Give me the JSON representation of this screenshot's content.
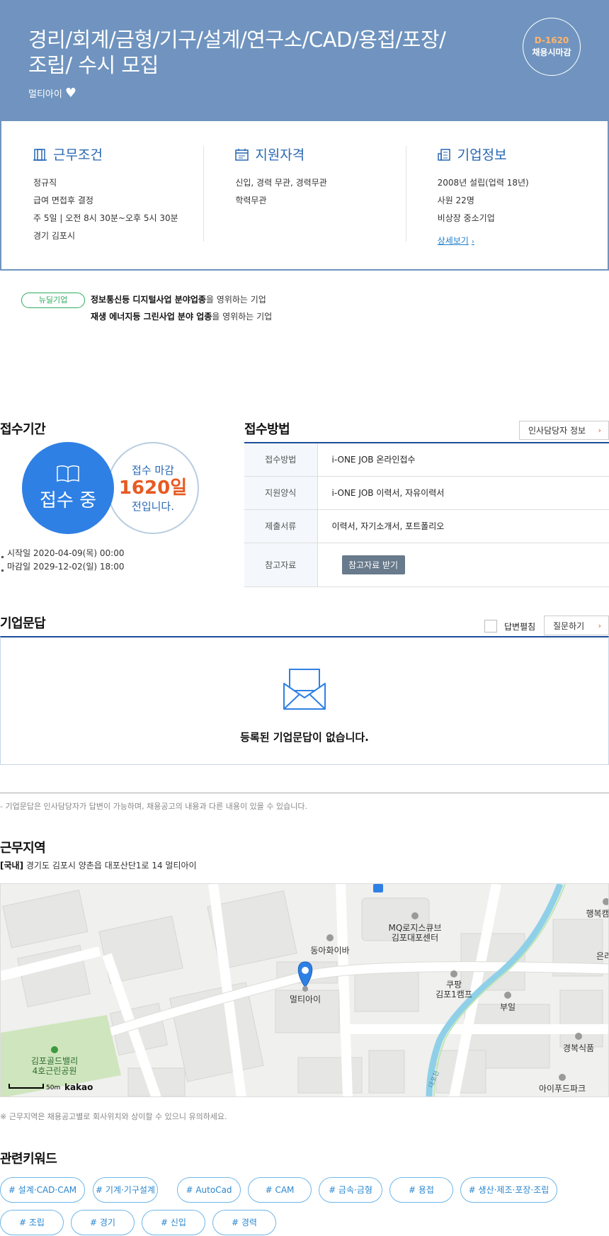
{
  "header": {
    "title_line1": "경리/회계/금형/기구/설계/연구소/CAD/용접/포장/",
    "title_line2": "조립/ 수시 모집",
    "company": "멀티아이",
    "dday_num": "D-1620",
    "dday_label": "채용시마감"
  },
  "info": {
    "work": {
      "title": "근무조건",
      "lines": [
        "정규직",
        "급여 면접후 결정",
        "주 5일 | 오전 8시 30분~오후 5시 30분",
        "경기 김포시"
      ]
    },
    "qualify": {
      "title": "지원자격",
      "lines": [
        "신입, 경력 무관, 경력무관",
        "학력무관"
      ]
    },
    "company": {
      "title": "기업정보",
      "lines": [
        "2008년 설립(업력 18년)",
        "사원 22명",
        "비상장 중소기업"
      ],
      "more": "상세보기"
    }
  },
  "new_deal": {
    "badge": "뉴딜기업",
    "line1_bold": "정보통신등 디지털사업 분야업종",
    "line1_rest": "을 영위하는 기업",
    "line2_bold": "재생 에너지등 그린사업 분야 업종",
    "line2_rest": "을 영위하는 기업"
  },
  "period": {
    "title": "접수기간",
    "status": "접수 중",
    "deadline_label": "접수 마감",
    "deadline_days": "1620일",
    "deadline_suffix": "전입니다.",
    "start": "시작일 2020-04-09(목) 00:00",
    "end": "마감일 2029-12-02(일) 18:00"
  },
  "method": {
    "title": "접수방법",
    "hr_button": "인사담당자 정보",
    "rows": [
      {
        "label": "접수방법",
        "value": "i-ONE JOB 온라인접수"
      },
      {
        "label": "지원양식",
        "value": "i-ONE JOB 이력서, 자유이력서"
      },
      {
        "label": "제출서류",
        "value": "이력서, 자기소개서, 포트폴리오"
      },
      {
        "label": "참고자료",
        "value": ""
      }
    ],
    "ref_button": "참고자료 받기"
  },
  "qa": {
    "title": "기업문답",
    "toggle_label": "답변펼침",
    "ask_button": "질문하기",
    "empty": "등록된 기업문답이 없습니다.",
    "note": "- 기업문답은 인사담당자가 답변이 가능하며, 채용공고의 내용과 다른 내용이 있을 수 있습니다."
  },
  "location": {
    "title": "근무지역",
    "region": "[국내]",
    "address": "경기도 김포시 양촌읍 대포산단1로 14 멀티아이",
    "note": "※ 근무지역은 채용공고별로 회사위치와 상이할 수 있으니 유의하세요.",
    "map": {
      "labels": {
        "mq1": "MQ로지스큐브",
        "mq2": "김포대포센터",
        "dong": "동아화이바",
        "multi": "멀티아이",
        "coupang1": "쿠팡",
        "coupang2": "김포1캠프",
        "buil": "부일",
        "haengbok": "행복캠",
        "eun": "은리",
        "gyeongbok": "경복식품",
        "ifood": "아이푸드파크",
        "park1": "김포골드밸리",
        "park2": "4호근린공원",
        "stream": "대포천",
        "scale": "50m",
        "brand": "kakao"
      }
    }
  },
  "keywords": {
    "title": "관련키워드",
    "items": [
      "# 설계·CAD·CAM",
      "# 기계·기구설계",
      "# AutoCad",
      "# CAM",
      "# 금속·금형",
      "# 용접",
      "# 생산·제조·포장·조립",
      "# 조립",
      "# 경기",
      "# 신입",
      "# 경력"
    ]
  },
  "colors": {
    "header_bg": "#7094bf",
    "accent_blue": "#2f80e4",
    "accent_orange": "#e75a22",
    "navy": "#1d4e9b",
    "green": "#2eac5e"
  }
}
